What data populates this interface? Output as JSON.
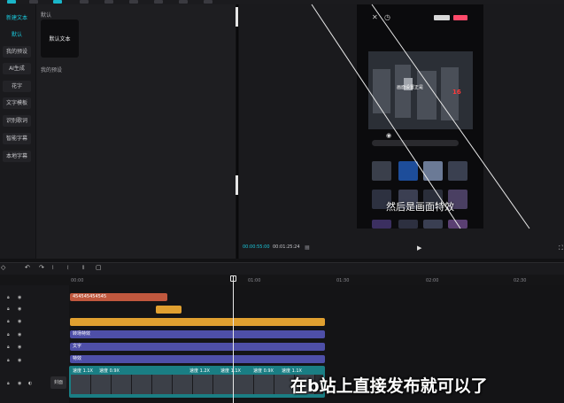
{
  "left_panel": {
    "header": "文字模版",
    "items": [
      {
        "label": "新建文本",
        "active": true
      },
      {
        "label": "默认",
        "active": true
      },
      {
        "label": "我的预设",
        "active": false
      },
      {
        "label": "AI生成",
        "active": false
      },
      {
        "label": "花字",
        "active": false
      },
      {
        "label": "文字模板",
        "active": false
      },
      {
        "label": "识别歌词",
        "active": false
      },
      {
        "label": "智能字幕",
        "active": false
      },
      {
        "label": "本地字幕",
        "active": false
      }
    ]
  },
  "material_panel": {
    "section_label": "默认",
    "tile_label": "默认文本",
    "preset_label": "我的预设"
  },
  "player": {
    "current_time": "00:00:55:00",
    "total_time": "00:01:25:24",
    "subtitle": "然后是画面特效",
    "video_overlay_text": "画面设置正是",
    "video_overlay_number": "16"
  },
  "timeline": {
    "ruler_ticks": [
      "00:00",
      "01:00",
      "01:30",
      "02:00",
      "02:30"
    ],
    "text_clips": [
      {
        "label": "454545454545",
        "color": "#c0583e"
      },
      {
        "label": "",
        "color": "#e0a030"
      },
      {
        "label": "",
        "color": "#e0a030"
      },
      {
        "label": "转场特效",
        "color": "#4e4fa8"
      },
      {
        "label": "文字",
        "color": "#4e4fa8"
      },
      {
        "label": "特效",
        "color": "#4e4fa8"
      }
    ],
    "speed_labels": [
      "速度 1.1X",
      "速度 0.9X",
      "速度 1.2X",
      "速度 1.1X",
      "速度 0.9X",
      "速度 1.1X"
    ],
    "cover_label": "封面",
    "caption": "在b站上直接发布就可以了"
  },
  "colors": {
    "accent": "#1ac8dc",
    "video_track": "#1a7e84",
    "text_track": "#4e4fa8",
    "sticker_track": "#e0a030",
    "title_track": "#c0583e"
  }
}
